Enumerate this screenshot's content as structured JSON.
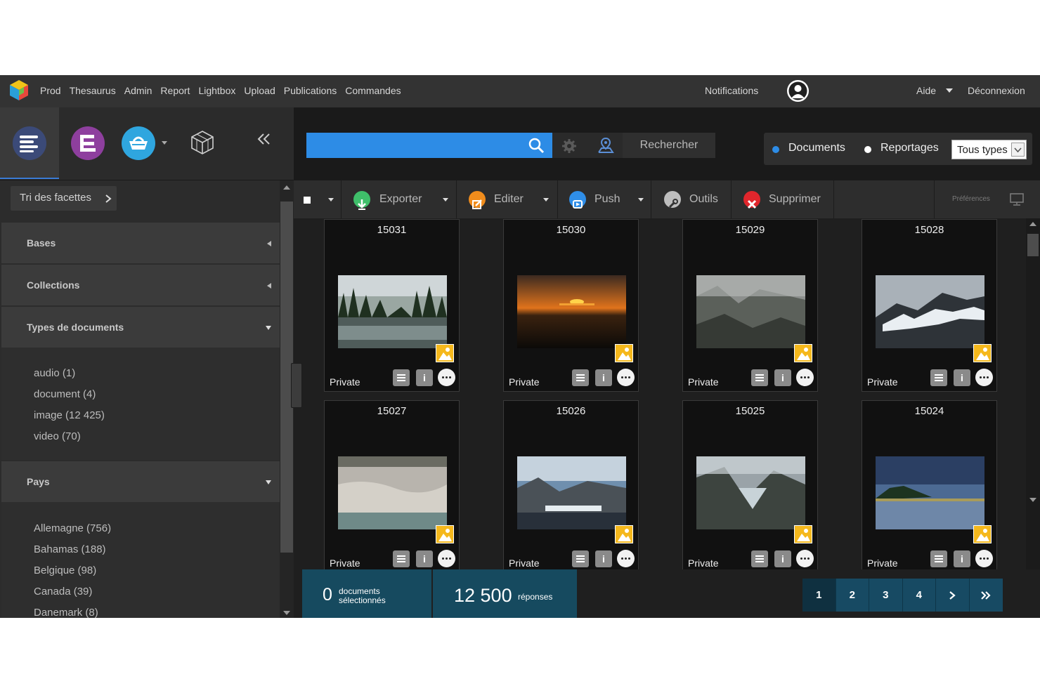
{
  "topbar": {
    "nav": [
      "Prod",
      "Thesaurus",
      "Admin",
      "Report",
      "Lightbox",
      "Upload",
      "Publications",
      "Commandes"
    ],
    "notifications": "Notifications",
    "help": "Aide",
    "logout": "Déconnexion"
  },
  "sidebar": {
    "sort_label": "Tri des facettes",
    "facets": {
      "bases": "Bases",
      "collections": "Collections",
      "types": {
        "title": "Types de documents",
        "items": [
          "audio (1)",
          "document (4)",
          "image (12 425)",
          "video (70)"
        ]
      },
      "pays": {
        "title": "Pays",
        "items": [
          "Allemagne (756)",
          "Bahamas (188)",
          "Belgique (98)",
          "Canada (39)",
          "Danemark (8)"
        ]
      }
    }
  },
  "search": {
    "query": "",
    "button": "Rechercher",
    "types": [
      "Documents",
      "Reportages"
    ],
    "filter": "Tous types"
  },
  "toolbar": {
    "export": "Exporter",
    "edit": "Editer",
    "push": "Push",
    "tools": "Outils",
    "delete": "Supprimer",
    "preferences": "Préférences"
  },
  "records": [
    {
      "id": "15031",
      "status": "Private"
    },
    {
      "id": "15030",
      "status": "Private"
    },
    {
      "id": "15029",
      "status": "Private"
    },
    {
      "id": "15028",
      "status": "Private"
    },
    {
      "id": "15027",
      "status": "Private"
    },
    {
      "id": "15026",
      "status": "Private"
    },
    {
      "id": "15025",
      "status": "Private"
    },
    {
      "id": "15024",
      "status": "Private"
    }
  ],
  "footer": {
    "selected_count": "0",
    "selected_label": [
      "documents",
      "sélectionnés"
    ],
    "results_count": "12 500",
    "results_label": "réponses",
    "pages": [
      "1",
      "2",
      "3",
      "4"
    ]
  },
  "colors": {
    "accent": "#2d8ce6",
    "footer": "#164a5f",
    "thumbnail_badge": "#f5b81c"
  }
}
